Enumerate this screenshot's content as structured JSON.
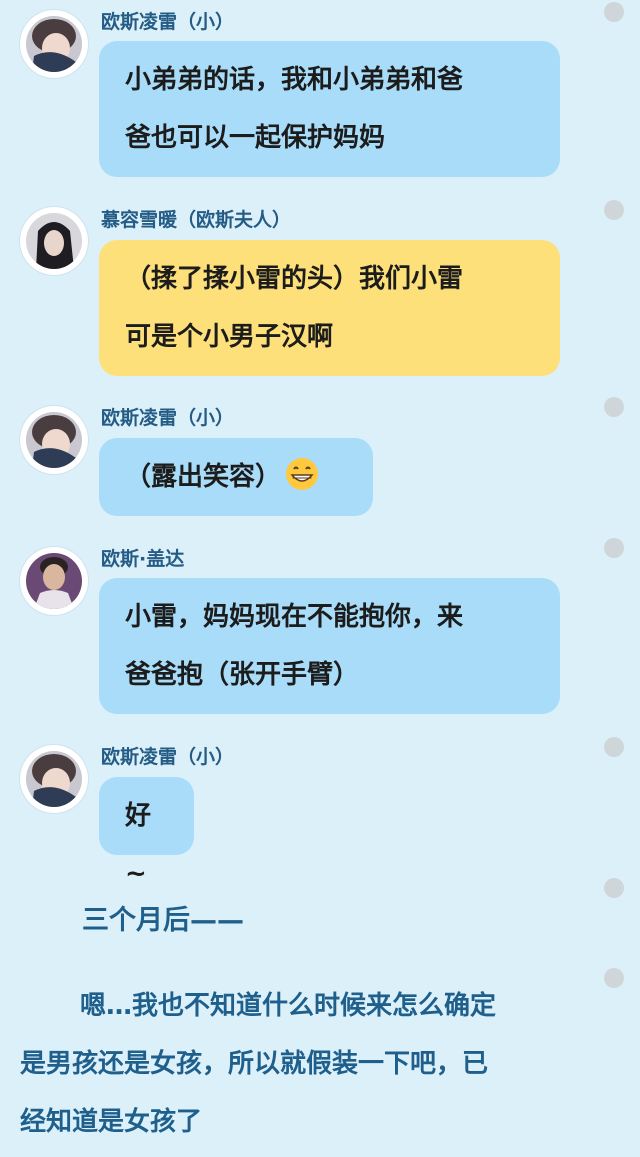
{
  "messages": [
    {
      "sender": "欧斯凌雷（小）",
      "lines": [
        "小弟弟的话，我和小弟弟和爸",
        "爸也可以一起保护妈妈"
      ],
      "bubble_color": "#a8dcf8"
    },
    {
      "sender": "慕容雪暖（欧斯夫人）",
      "lines": [
        "（揉了揉小雷的头）我们小雷",
        "可是个小男子汉啊"
      ],
      "bubble_color": "#fde07a"
    },
    {
      "sender": "欧斯凌雷（小）",
      "lines": [
        "（露出笑容）"
      ],
      "emoji": "grinning-face-icon",
      "bubble_color": "#a8dcf8"
    },
    {
      "sender": "欧斯·盖达",
      "lines": [
        "小雷，妈妈现在不能抱你，来",
        "爸爸抱（张开手臂）"
      ],
      "bubble_color": "#a8dcf8"
    },
    {
      "sender": "欧斯凌雷（小）",
      "lines": [
        "好~"
      ],
      "bubble_color": "#a8dcf8"
    }
  ],
  "narration": {
    "time_skip": "三个月后——",
    "paragraph_lines": [
      "嗯…我也不知道什么时候来怎么确定",
      "是男孩还是女孩，所以就假装一下吧，已",
      "经知道是女孩了"
    ]
  },
  "colors": {
    "background": "#dcf0fa",
    "name_text": "#245c86",
    "narration_text": "#1f5f8c",
    "side_dot": "#cfd6da"
  }
}
